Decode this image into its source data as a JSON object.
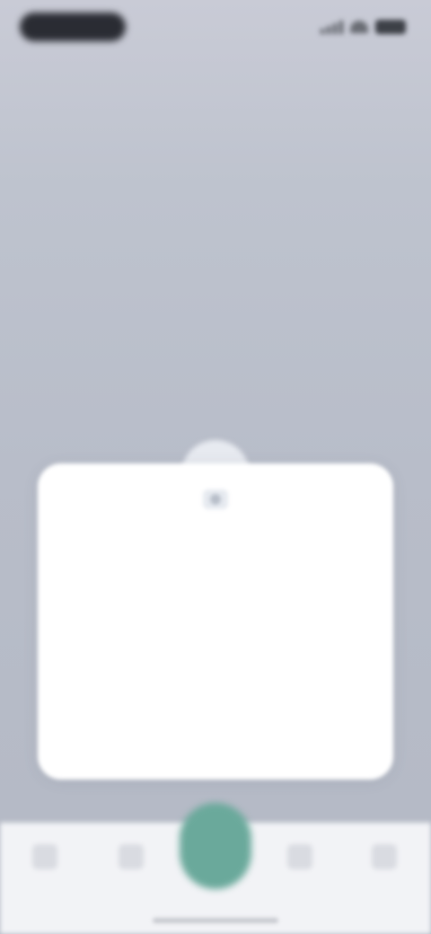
{
  "status_bar": {
    "time": "",
    "icons": [
      "signal-icon",
      "wifi-icon",
      "battery-icon"
    ]
  },
  "modal": {
    "icon": "info-icon",
    "title": "",
    "paragraphs": [
      "",
      ""
    ]
  },
  "bottom_nav": {
    "items": [
      "nav-item",
      "nav-item",
      "nav-item",
      "nav-item"
    ],
    "center_action": "add-button"
  },
  "colors": {
    "backdrop": "#b8bdc9",
    "modal": "#ffffff",
    "accent": "#6aa99b"
  }
}
